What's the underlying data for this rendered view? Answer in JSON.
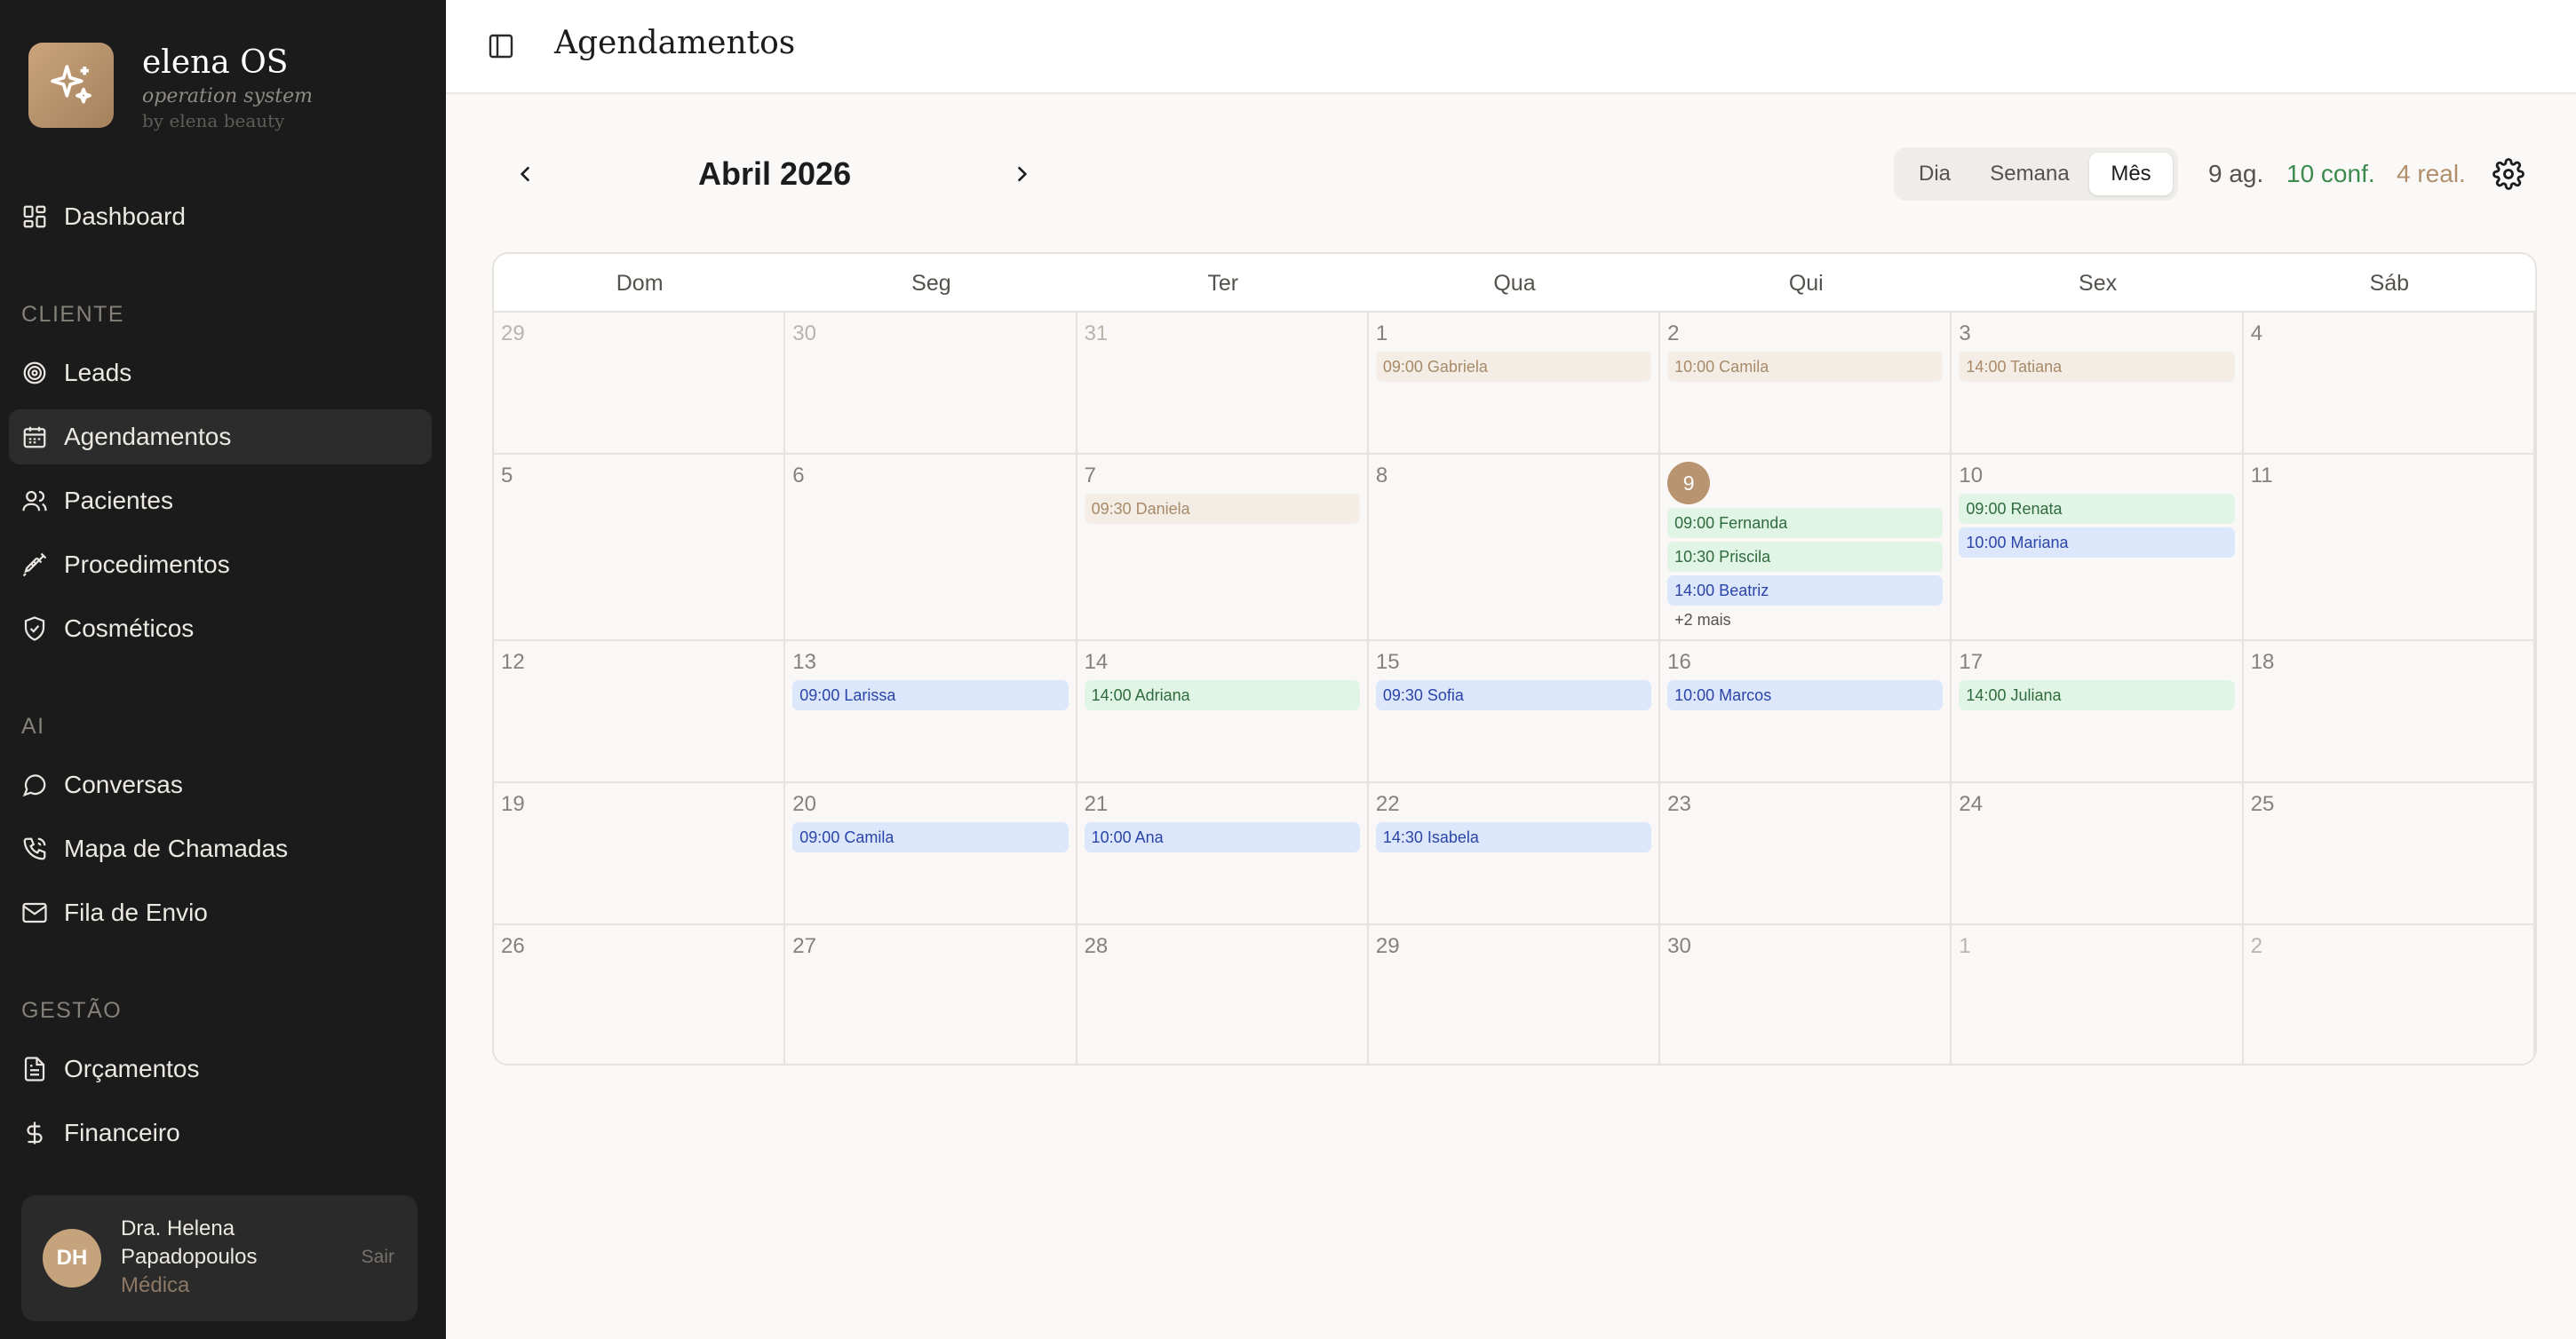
{
  "brand": {
    "name": "elena OS",
    "subtitle": "operation system",
    "by": "by elena beauty"
  },
  "nav": {
    "dashboard": "Dashboard",
    "section_cliente": "CLIENTE",
    "leads": "Leads",
    "agendamentos": "Agendamentos",
    "pacientes": "Pacientes",
    "procedimentos": "Procedimentos",
    "cosmeticos": "Cosméticos",
    "section_ai": "AI",
    "conversas": "Conversas",
    "mapa": "Mapa de Chamadas",
    "fila": "Fila de Envio",
    "section_gestao": "GESTÃO",
    "orcamentos": "Orçamentos",
    "financeiro": "Financeiro"
  },
  "user": {
    "initials": "DH",
    "name": "Dra. Helena Papadopoulos",
    "role": "Médica",
    "logout": "Sair"
  },
  "header": {
    "title": "Agendamentos"
  },
  "calendar": {
    "month_label": "Abril 2026",
    "views": [
      "Dia",
      "Semana",
      "Mês"
    ],
    "active_view": "Mês",
    "stats": {
      "scheduled": "9 ag.",
      "confirmed": "10 conf.",
      "done": "4 real."
    },
    "colors": {
      "confirmed": "#3c8a4d",
      "done": "#b08f6a",
      "accent": "#b89470"
    },
    "weekdays": [
      "Dom",
      "Seg",
      "Ter",
      "Qua",
      "Qui",
      "Sex",
      "Sáb"
    ],
    "weeks": [
      [
        {
          "day": "29",
          "other": true,
          "events": []
        },
        {
          "day": "30",
          "other": true,
          "events": []
        },
        {
          "day": "31",
          "other": true,
          "events": []
        },
        {
          "day": "1",
          "events": [
            {
              "label": "09:00 Gabriela",
              "kind": "beige"
            }
          ]
        },
        {
          "day": "2",
          "events": [
            {
              "label": "10:00 Camila",
              "kind": "beige"
            }
          ]
        },
        {
          "day": "3",
          "events": [
            {
              "label": "14:00 Tatiana",
              "kind": "beige"
            }
          ]
        },
        {
          "day": "4",
          "events": []
        }
      ],
      [
        {
          "day": "5",
          "events": []
        },
        {
          "day": "6",
          "events": []
        },
        {
          "day": "7",
          "events": [
            {
              "label": "09:30 Daniela",
              "kind": "beige"
            }
          ]
        },
        {
          "day": "8",
          "events": []
        },
        {
          "day": "9",
          "today": true,
          "events": [
            {
              "label": "09:00 Fernanda",
              "kind": "green"
            },
            {
              "label": "10:30 Priscila",
              "kind": "green"
            },
            {
              "label": "14:00 Beatriz",
              "kind": "blue"
            }
          ],
          "more": "+2 mais"
        },
        {
          "day": "10",
          "events": [
            {
              "label": "09:00 Renata",
              "kind": "green"
            },
            {
              "label": "10:00 Mariana",
              "kind": "blue"
            }
          ]
        },
        {
          "day": "11",
          "events": []
        }
      ],
      [
        {
          "day": "12",
          "events": []
        },
        {
          "day": "13",
          "events": [
            {
              "label": "09:00 Larissa",
              "kind": "blue"
            }
          ]
        },
        {
          "day": "14",
          "events": [
            {
              "label": "14:00 Adriana",
              "kind": "green"
            }
          ]
        },
        {
          "day": "15",
          "events": [
            {
              "label": "09:30 Sofia",
              "kind": "blue"
            }
          ]
        },
        {
          "day": "16",
          "events": [
            {
              "label": "10:00 Marcos",
              "kind": "blue"
            }
          ]
        },
        {
          "day": "17",
          "events": [
            {
              "label": "14:00 Juliana",
              "kind": "green"
            }
          ]
        },
        {
          "day": "18",
          "events": []
        }
      ],
      [
        {
          "day": "19",
          "events": []
        },
        {
          "day": "20",
          "events": [
            {
              "label": "09:00 Camila",
              "kind": "blue"
            }
          ]
        },
        {
          "day": "21",
          "events": [
            {
              "label": "10:00 Ana",
              "kind": "blue"
            }
          ]
        },
        {
          "day": "22",
          "events": [
            {
              "label": "14:30 Isabela",
              "kind": "blue"
            }
          ]
        },
        {
          "day": "23",
          "events": []
        },
        {
          "day": "24",
          "events": []
        },
        {
          "day": "25",
          "events": []
        }
      ],
      [
        {
          "day": "26",
          "events": []
        },
        {
          "day": "27",
          "events": []
        },
        {
          "day": "28",
          "events": []
        },
        {
          "day": "29",
          "events": []
        },
        {
          "day": "30",
          "events": []
        },
        {
          "day": "1",
          "other": true,
          "events": []
        },
        {
          "day": "2",
          "other": true,
          "events": []
        }
      ]
    ]
  }
}
